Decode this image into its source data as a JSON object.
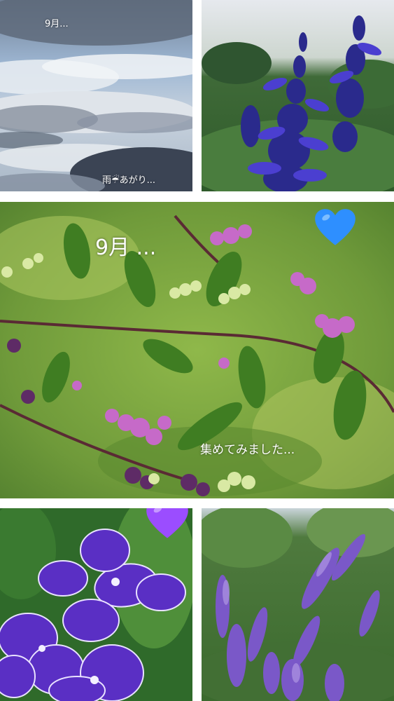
{
  "collage": {
    "sky_tile": {
      "caption_top": "9月...",
      "caption_bottom": "雨☔あがり..."
    },
    "salvia_tile": {},
    "beautyberry_tile": {
      "caption_top": "9月 ...",
      "caption_bottom": "集めてみました...",
      "heart_color": "#2e8fff",
      "heart_icon": "blue-heart-icon"
    },
    "duranta_tile": {
      "heart_color": "#9b4dff",
      "heart_icon": "purple-heart-icon"
    },
    "vitex_tile": {}
  }
}
